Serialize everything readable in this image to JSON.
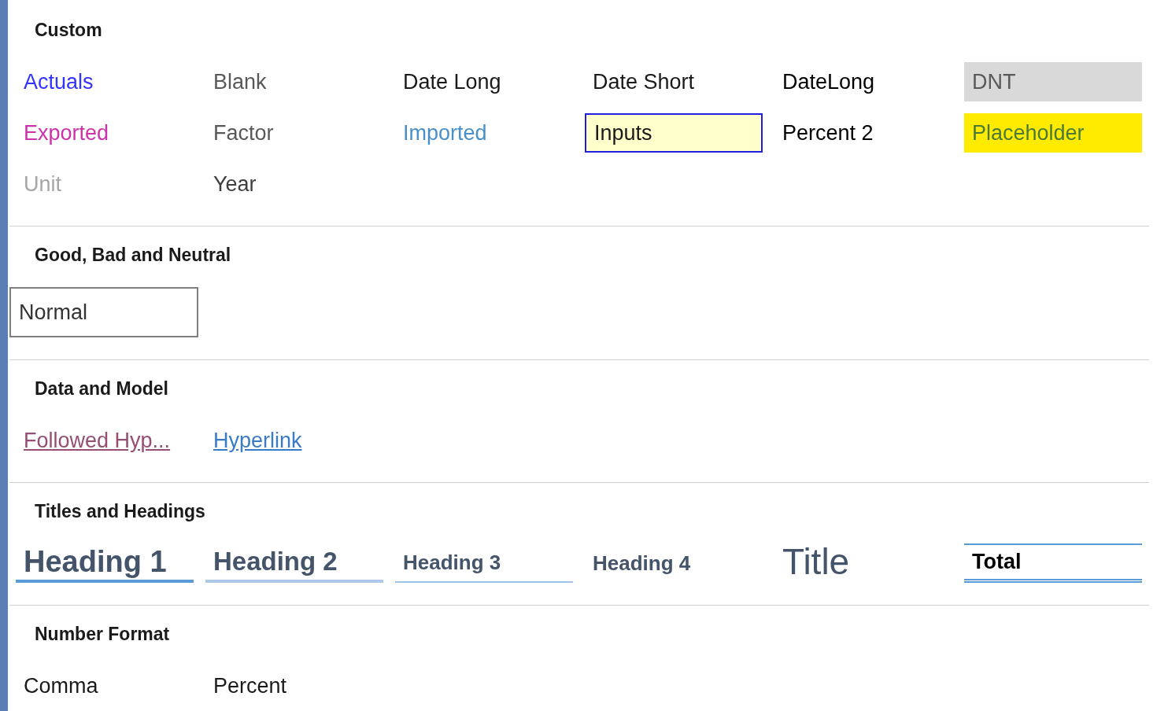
{
  "sections": [
    {
      "title": "Custom",
      "items": [
        {
          "label": "Actuals",
          "kind": "text",
          "color": "#3333ff"
        },
        {
          "label": "Blank",
          "kind": "text",
          "color": "#595959"
        },
        {
          "label": "Date Long",
          "kind": "text",
          "color": "#1a1a1a"
        },
        {
          "label": "Date Short",
          "kind": "text",
          "color": "#1a1a1a"
        },
        {
          "label": "DateLong",
          "kind": "text",
          "color": "#000000"
        },
        {
          "label": "DNT",
          "kind": "shaded"
        },
        {
          "label": "Exported",
          "kind": "text",
          "color": "#cc33aa"
        },
        {
          "label": "Factor",
          "kind": "text",
          "color": "#595959"
        },
        {
          "label": "Imported",
          "kind": "text",
          "color": "#4a90c8"
        },
        {
          "label": "Inputs",
          "kind": "input"
        },
        {
          "label": "Percent 2",
          "kind": "text",
          "color": "#000000"
        },
        {
          "label": "Placeholder",
          "kind": "highlight"
        },
        {
          "label": "Unit",
          "kind": "text",
          "color": "#a6a6a6"
        },
        {
          "label": "Year",
          "kind": "text",
          "color": "#404040"
        }
      ]
    },
    {
      "title": "Good, Bad and Neutral",
      "items": [
        {
          "label": "Normal",
          "kind": "boxed"
        }
      ]
    },
    {
      "title": "Data and Model",
      "items": [
        {
          "label": "Followed Hyp...",
          "kind": "visited"
        },
        {
          "label": "Hyperlink",
          "kind": "link"
        }
      ]
    },
    {
      "title": "Titles and Headings",
      "items": [
        {
          "label": "Heading 1",
          "kind": "heading1"
        },
        {
          "label": "Heading 2",
          "kind": "heading2"
        },
        {
          "label": "Heading 3",
          "kind": "heading3"
        },
        {
          "label": "Heading 4",
          "kind": "heading4"
        },
        {
          "label": "Title",
          "kind": "title"
        },
        {
          "label": "Total",
          "kind": "total"
        }
      ]
    },
    {
      "title": "Number Format",
      "items": [
        {
          "label": "Comma",
          "kind": "text",
          "color": "#1a1a1a"
        },
        {
          "label": "Percent",
          "kind": "text",
          "color": "#1a1a1a"
        }
      ]
    }
  ]
}
